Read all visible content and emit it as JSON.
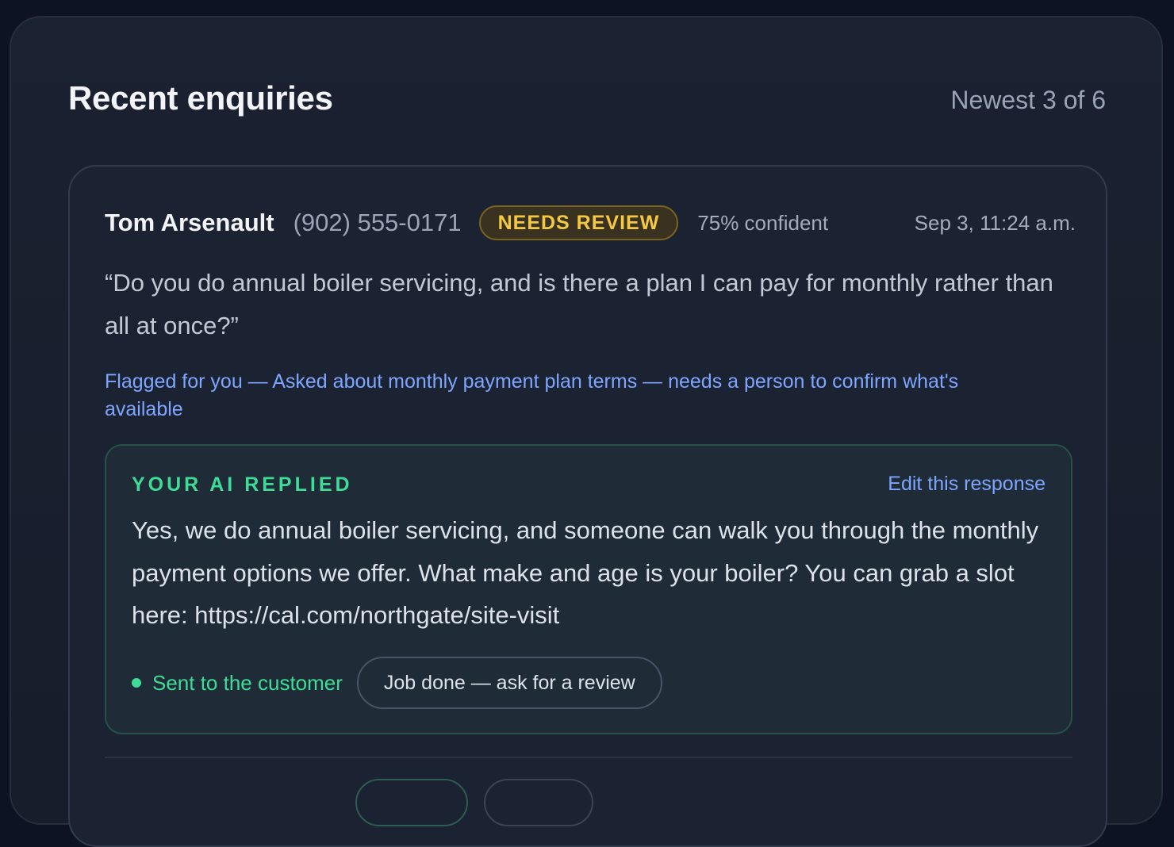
{
  "panel": {
    "title": "Recent enquiries",
    "count_label": "Newest 3 of 6"
  },
  "enquiry": {
    "name": "Tom Arsenault",
    "phone": "(902) 555-0171",
    "badge": "NEEDS REVIEW",
    "confidence": "75% confident",
    "timestamp": "Sep 3, 11:24 a.m.",
    "message": "“Do you do annual boiler servicing, and is there a plan I can pay for monthly rather than all at once?”",
    "flag_note": "Flagged for you — Asked about monthly payment plan terms — needs a person to confirm what's available",
    "reply": {
      "label": "YOUR AI REPLIED",
      "edit_label": "Edit this response",
      "text": "Yes, we do annual boiler servicing, and someone can walk you through the monthly payment options we offer. What make and age is your boiler? You can grab a slot here: https://cal.com/northgate/site-visit",
      "status": "Sent to the customer",
      "review_button": "Job done — ask for a review"
    }
  },
  "colors": {
    "background": "#0d1322",
    "panel": "#1a2130",
    "badge_text": "#f5c842",
    "accent_green": "#3ddc97",
    "link_blue": "#7ea6ff"
  }
}
